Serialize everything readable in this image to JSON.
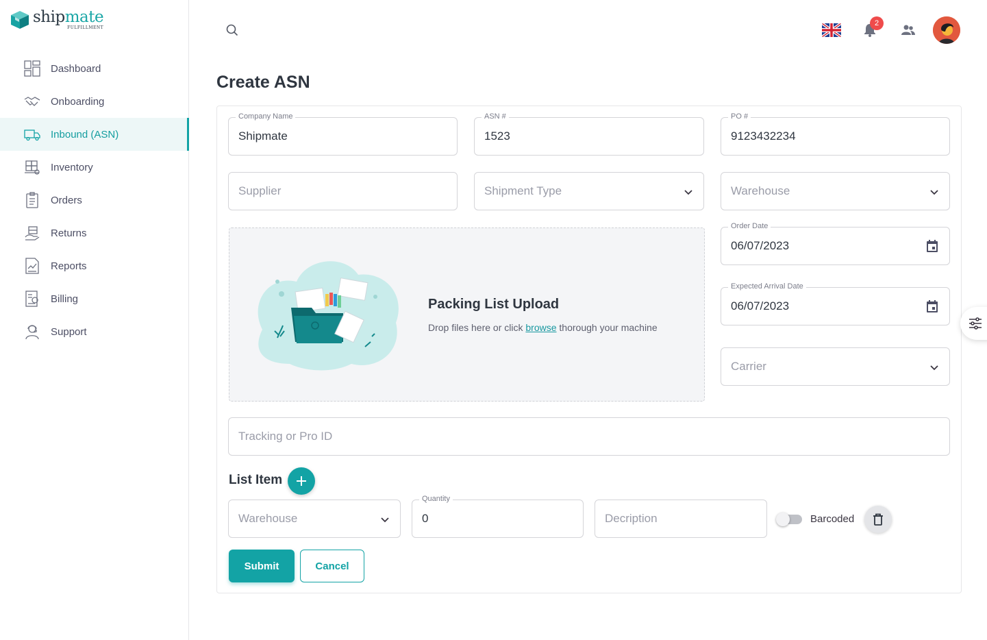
{
  "logo": {
    "word_main": "ship",
    "word_accent": "mate",
    "sub": "FULFILLMENT"
  },
  "sidebar": {
    "items": [
      {
        "label": "Dashboard",
        "icon": "dashboard-icon",
        "active": false
      },
      {
        "label": "Onboarding",
        "icon": "handshake-icon",
        "active": false
      },
      {
        "label": "Inbound (ASN)",
        "icon": "truck-icon",
        "active": true
      },
      {
        "label": "Inventory",
        "icon": "inventory-icon",
        "active": false
      },
      {
        "label": "Orders",
        "icon": "clipboard-icon",
        "active": false
      },
      {
        "label": "Returns",
        "icon": "returns-icon",
        "active": false
      },
      {
        "label": "Reports",
        "icon": "report-icon",
        "active": false
      },
      {
        "label": "Billing",
        "icon": "billing-icon",
        "active": false
      },
      {
        "label": "Support",
        "icon": "support-agent-icon",
        "active": false
      }
    ]
  },
  "header": {
    "notification_count": "2",
    "language": "uk-flag-icon"
  },
  "page": {
    "title": "Create ASN"
  },
  "form": {
    "company_name": {
      "label": "Company Name",
      "value": "Shipmate"
    },
    "asn": {
      "label": "ASN #",
      "value": "1523"
    },
    "po": {
      "label": "PO #",
      "value": "9123432234"
    },
    "supplier": {
      "placeholder": "Supplier"
    },
    "shipment_type": {
      "placeholder": "Shipment Type"
    },
    "warehouse": {
      "placeholder": "Warehouse"
    },
    "order_date": {
      "label": "Order Date",
      "value": "06/07/2023"
    },
    "expected_arrival_date": {
      "label": "Expected Arrival Date",
      "value": "06/07/2023"
    },
    "carrier": {
      "placeholder": "Carrier"
    },
    "tracking": {
      "placeholder": "Tracking or Pro ID"
    },
    "upload": {
      "title": "Packing List Upload",
      "text_before": "Drop files here or click ",
      "link": "browse",
      "text_after": " thorough your machine"
    }
  },
  "list_item": {
    "title": "List Item",
    "warehouse_placeholder": "Warehouse",
    "quantity_label": "Quantity",
    "quantity_value": "0",
    "description_placeholder": "Decription",
    "barcoded_label": "Barcoded",
    "barcoded_checked": false
  },
  "actions": {
    "submit": "Submit",
    "cancel": "Cancel"
  },
  "colors": {
    "accent": "#13a3a5",
    "badge": "#ef4b4b",
    "text": "#2f3640"
  }
}
